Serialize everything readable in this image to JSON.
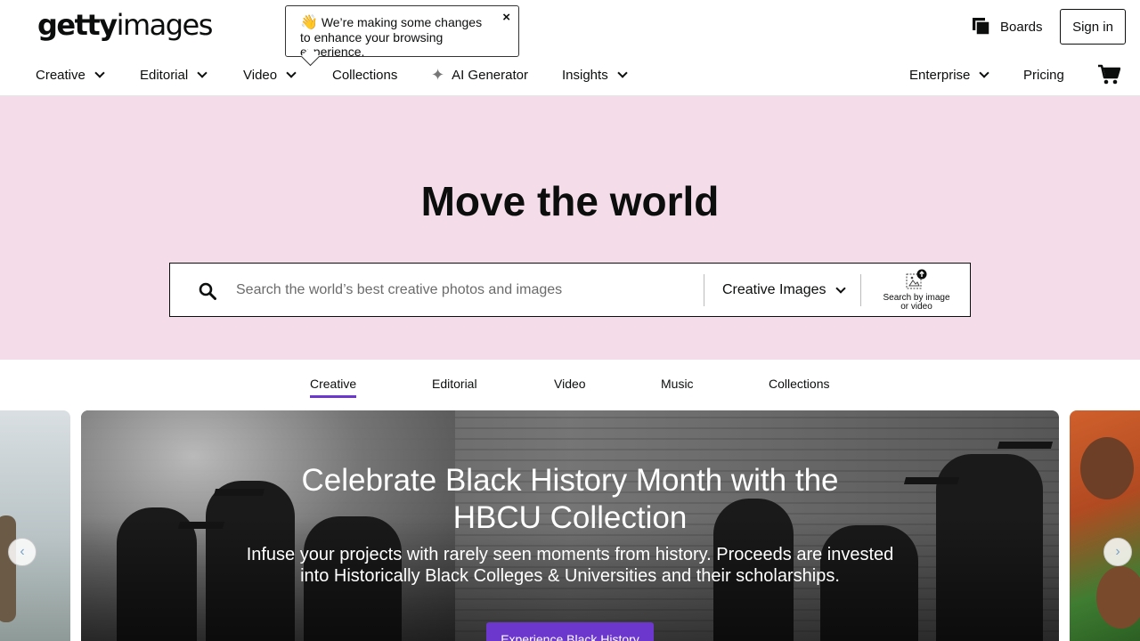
{
  "header": {
    "logo": {
      "bold": "getty",
      "light": "images"
    },
    "toast": {
      "emoji": "👋",
      "message": "We’re making some changes to enhance your browsing experience.",
      "close": "×"
    },
    "boards_label": "Boards",
    "signin_label": "Sign in"
  },
  "nav": {
    "items": [
      {
        "label": "Creative",
        "dropdown": true
      },
      {
        "label": "Editorial",
        "dropdown": true
      },
      {
        "label": "Video",
        "dropdown": true
      },
      {
        "label": "Collections",
        "dropdown": false
      },
      {
        "label": "AI Generator",
        "dropdown": false
      },
      {
        "label": "Insights",
        "dropdown": true
      }
    ],
    "right": [
      {
        "label": "Enterprise",
        "dropdown": true
      },
      {
        "label": "Pricing",
        "dropdown": false
      }
    ],
    "spark_glyph": "✦"
  },
  "hero": {
    "title": "Move the world",
    "search": {
      "placeholder": "Search the world’s best creative photos and images",
      "type_selected": "Creative Images",
      "by_image_line1": "Search by image",
      "by_image_line2": "or video"
    }
  },
  "tabs": [
    "Creative",
    "Editorial",
    "Video",
    "Music",
    "Collections"
  ],
  "feature": {
    "title_line1": "Celebrate Black History Month with the",
    "title_line2": "HBCU Collection",
    "subtitle_line1": "Infuse your projects with rarely seen moments from history. Proceeds are invested",
    "subtitle_line2": "into Historically Black Colleges & Universities and their scholarships.",
    "cta": "Experience Black History"
  },
  "carousel": {
    "prev": "‹",
    "next": "›"
  },
  "colors": {
    "hero_bg": "#f4dde9",
    "accent": "#6b37cc",
    "text": "#0c0d0d"
  }
}
